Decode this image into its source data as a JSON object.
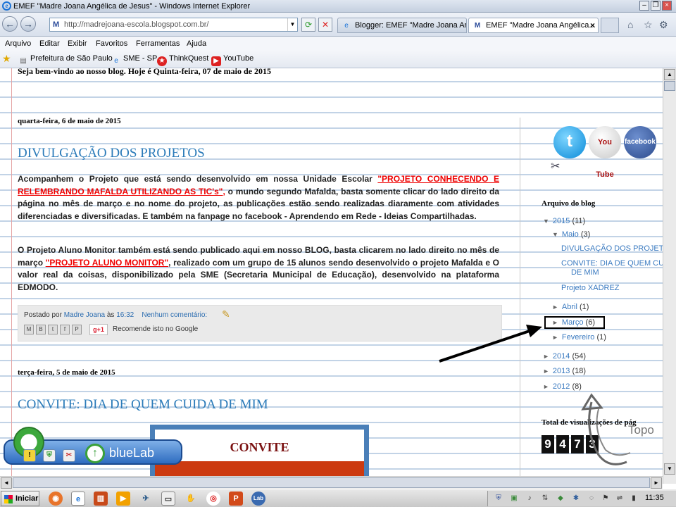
{
  "window": {
    "title": "EMEF \"Madre Joana Angélica de Jesus\" - Windows Internet Explorer",
    "ie_icon": "e"
  },
  "address": {
    "favicon_text": "M",
    "url": "http://madrejoana-escola.blogspot.com.br/"
  },
  "tabs": [
    {
      "label": "Blogger: EMEF \"Madre Joana An...",
      "icon": "blogger-icon"
    },
    {
      "label": "EMEF \"Madre Joana Angélica...",
      "icon": "M",
      "close": "×"
    }
  ],
  "menu": [
    "Arquivo",
    "Editar",
    "Exibir",
    "Favoritos",
    "Ferramentas",
    "Ajuda"
  ],
  "favorites": [
    {
      "label": "Prefeitura de São Paulo"
    },
    {
      "label": "SME - SP"
    },
    {
      "label": "ThinkQuest"
    },
    {
      "label": "YouTube"
    }
  ],
  "page": {
    "welcome": "Seja bem-vindo ao nosso blog. Hoje é Quinta-feira, 07 de maio de 2015",
    "posts": [
      {
        "date": "quarta-feira, 6 de maio de 2015",
        "title": "DIVULGAÇÃO DOS PROJETOS",
        "p1_a": "Acompanhem o Projeto que está sendo desenvolvido em nossa Unidade Escolar ",
        "p1_link": "\"PROJETO CONHECENDO E RELEMBRANDO MAFALDA UTILIZANDO AS TIC's\",",
        "p1_b": " o mundo segundo Mafalda, basta somente clicar do lado direito da página no mês de março e no nome do projeto, as publicações estão sendo realizadas diaramente com atividades diferenciadas e diversificadas. E também na fanpage no facebook - Aprendendo em Rede - Ideias Compartilhadas.",
        "p2_a": "O Projeto Aluno Monitor também está sendo publicado aqui em nosso BLOG, basta clicarem no lado direito no mês de março ",
        "p2_link": "\"PROJETO ALUNO MONITOR\"",
        "p2_b": ", realizado com um grupo de 15 alunos sendo desenvolvido o projeto Mafalda e O valor real da coisas, disponibilizado pela SME (Secretaria Municipal de Educação), desenvolvido na plataforma EDMODO.",
        "footer": {
          "posted_by": "Postado por",
          "author": "Madre Joana",
          "at": "às",
          "time": "16:32",
          "comments": "Nenhum comentário:",
          "share": [
            "M",
            "B",
            "t",
            "f",
            "P"
          ],
          "gplus": "g+1",
          "recommend": "Recomende isto no Google"
        }
      },
      {
        "date": "terça-feira, 5 de maio de 2015",
        "title": "CONVITE: DIA DE QUEM CUIDA DE MIM",
        "image_text": "CONVITE"
      }
    ]
  },
  "sidebar": {
    "social": {
      "twitter": "t",
      "youtube": "You Tube",
      "facebook": "facebook"
    },
    "archive_title": "Arquivo do blog",
    "archive": {
      "y2015": {
        "tri": "▼",
        "label": "2015",
        "count": "(11)"
      },
      "maio": {
        "tri": "▼",
        "label": "Maio",
        "count": "(3)"
      },
      "maio_posts": [
        "DIVULGAÇÃO DOS PROJET",
        "CONVITE: DIA DE QUEM CU",
        "DE MIM",
        "Projeto XADREZ"
      ],
      "abril": {
        "tri": "►",
        "label": "Abril",
        "count": "(1)"
      },
      "marco": {
        "tri": "►",
        "label": "Março",
        "count": "(6)"
      },
      "fevereiro": {
        "tri": "►",
        "label": "Fevereiro",
        "count": "(1)"
      },
      "y2014": {
        "tri": "►",
        "label": "2014",
        "count": "(54)"
      },
      "y2013": {
        "tri": "►",
        "label": "2013",
        "count": "(18)"
      },
      "y2012": {
        "tri": "►",
        "label": "2012",
        "count": "(8)"
      }
    },
    "visits_title": "Total de visualizações de pág",
    "counter": [
      "9",
      "4",
      "7",
      "3"
    ],
    "topo": "Topo"
  },
  "bluelab": {
    "label": "blueLab"
  },
  "taskbar": {
    "start": "Iniciar",
    "clock": "11:35"
  },
  "colors": {
    "link_red": "#ee0000",
    "title_blue": "#2b7bb9",
    "link_blue": "#3a7ac0"
  }
}
